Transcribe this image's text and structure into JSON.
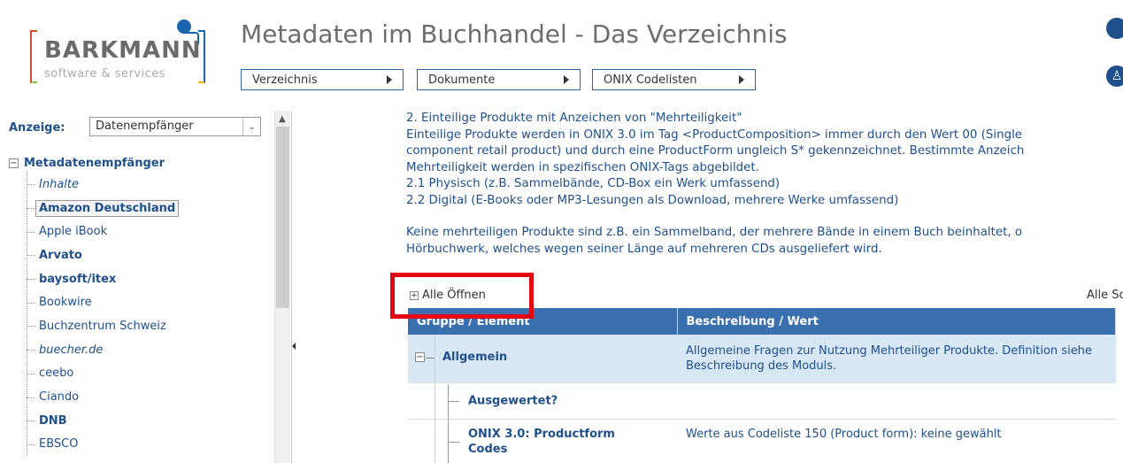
{
  "header": {
    "logo_text": "BARKMANN",
    "logo_sub": "software & services",
    "title": "Metadaten im Buchhandel - Das Verzeichnis",
    "nav": [
      {
        "label": "Verzeichnis"
      },
      {
        "label": "Dokumente"
      },
      {
        "label": "ONIX Codelisten"
      }
    ]
  },
  "sidebar": {
    "anzeige_label": "Anzeige:",
    "anzeige_value": "Datenempfänger",
    "root_label": "Metadatenempfänger",
    "items": [
      {
        "label": "Inhalte",
        "style": "italic"
      },
      {
        "label": "Amazon Deutschland",
        "style": "bold selected"
      },
      {
        "label": "Apple iBook",
        "style": ""
      },
      {
        "label": "Arvato",
        "style": "bold"
      },
      {
        "label": "baysoft/itex",
        "style": "bold"
      },
      {
        "label": "Bookwire",
        "style": ""
      },
      {
        "label": "Buchzentrum Schweiz",
        "style": ""
      },
      {
        "label": "buecher.de",
        "style": "italic"
      },
      {
        "label": "ceebo",
        "style": ""
      },
      {
        "label": "Ciando",
        "style": ""
      },
      {
        "label": "DNB",
        "style": "bold"
      },
      {
        "label": "EBSCO",
        "style": ""
      }
    ]
  },
  "content": {
    "lines_1": [
      "2. Einteilige Produkte mit Anzeichen von \"Mehrteiligkeit\"",
      "Einteilige Produkte werden in ONIX 3.0 im Tag <ProductComposition> immer durch den Wert 00 (Single",
      "component retail product) und durch eine ProductForm ungleich S* gekennzeichnet. Bestimmte Anzeich",
      "Mehrteiligkeit werden in spezifischen ONIX-Tags abgebildet.",
      "2.1 Physisch (z.B. Sammelbände, CD-Box ein Werk umfassend)",
      "2.2 Digital (E-Books oder MP3-Lesungen als Download, mehrere Werke umfassend)"
    ],
    "lines_2": [
      "Keine mehrteiligen Produkte sind z.B. ein Sammelband, der mehrere Bände in einem Buch beinhaltet, o",
      "Hörbuchwerk, welches wegen seiner Länge auf mehreren CDs ausgeliefert wird."
    ]
  },
  "table": {
    "open_all": "Alle Öffnen",
    "close_all": "Alle Sc",
    "col_group": "Gruppe / Element",
    "col_desc": "Beschreibung / Wert",
    "group_label": "Allgemein",
    "group_desc": "Allgemeine Fragen zur Nutzung Mehrteiliger Produkte. Definition siehe Beschreibung des Moduls.",
    "rows": [
      {
        "label": "Ausgewertet?",
        "desc": ""
      },
      {
        "label": "ONIX 3.0: Productform Codes",
        "desc": "Werte aus Codeliste 150 (Product form): keine gewählt"
      }
    ]
  }
}
